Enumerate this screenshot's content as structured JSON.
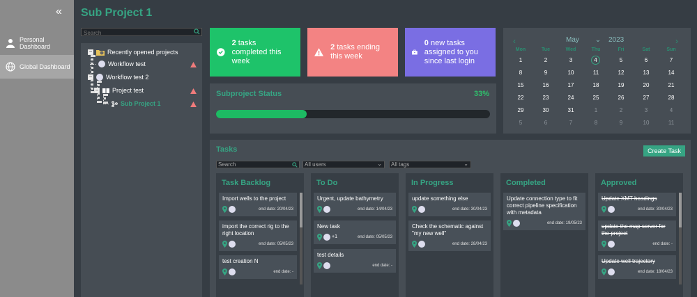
{
  "nav": {
    "items": [
      {
        "label": "Personal Dashboard",
        "icon": "person-icon"
      },
      {
        "label": "Global Dashboard",
        "icon": "globe-icon"
      }
    ]
  },
  "page_title": "Sub Project 1",
  "tree": {
    "search_placeholder": "Search",
    "root": "Recently opened projects",
    "items": [
      "Workflow test",
      "Workflow test 2",
      "Project test",
      "Sub Project 1"
    ]
  },
  "cards": [
    {
      "count": "2",
      "text": "tasks completed this week",
      "color": "#1ec36a"
    },
    {
      "count": "2",
      "text": "tasks ending this week",
      "color": "#f38383"
    },
    {
      "count": "0",
      "text": "new tasks assigned to you since last login",
      "color": "#7a6ee3"
    }
  ],
  "subproject": {
    "label": "Subproject Status",
    "percent_text": "33%",
    "progress": 0.33
  },
  "calendar": {
    "month": "May",
    "year": "2023",
    "dow": [
      "Mon",
      "Tue",
      "Wed",
      "Thu",
      "Fri",
      "Sat",
      "Sun"
    ],
    "days": [
      [
        "1",
        "2",
        "3",
        "4",
        "5",
        "6",
        "7"
      ],
      [
        "8",
        "9",
        "10",
        "11",
        "12",
        "13",
        "14"
      ],
      [
        "15",
        "16",
        "17",
        "18",
        "19",
        "20",
        "21"
      ],
      [
        "22",
        "23",
        "24",
        "25",
        "26",
        "27",
        "28"
      ],
      [
        "29",
        "30",
        "31",
        "1",
        "2",
        "3",
        "4"
      ],
      [
        "5",
        "6",
        "7",
        "8",
        "9",
        "10",
        "11"
      ]
    ]
  },
  "tasks": {
    "title": "Tasks",
    "create_label": "Create Task",
    "search_placeholder": "Search",
    "users_filter": "All users",
    "tags_filter": "All tags",
    "columns": [
      {
        "title": "Task Backlog",
        "cards": [
          {
            "text": "Import wells to the project",
            "end": "end date: 20/04/23"
          },
          {
            "text": "import the correct rig to the right location",
            "end": "end date: 05/05/23"
          },
          {
            "text": "test creation N",
            "end": "end date: -"
          }
        ]
      },
      {
        "title": "To Do",
        "cards": [
          {
            "text": "Urgent, update bathymetry",
            "end": "end date: 14/04/23"
          },
          {
            "text": "New task",
            "end": "end date: 05/05/23",
            "extra": "+1"
          },
          {
            "text": "test details",
            "end": "end date: -"
          }
        ]
      },
      {
        "title": "In Progress",
        "cards": [
          {
            "text": "update something else",
            "end": "end date: 30/04/23"
          },
          {
            "text": "Check the schematic against \"my new well\"",
            "end": "end date: 28/04/23"
          }
        ]
      },
      {
        "title": "Completed",
        "cards": [
          {
            "text": "Update connection type to fit correct pipeline specification with metadata",
            "end": "end date: 19/05/23"
          }
        ]
      },
      {
        "title": "Approved",
        "cards": [
          {
            "text": "Update XMT headings",
            "end": "end date: 30/04/23"
          },
          {
            "text": "update the map server for the project",
            "end": "end date: -"
          },
          {
            "text": "Update well trajectory",
            "end": "end date: 18/04/23"
          }
        ]
      }
    ]
  }
}
